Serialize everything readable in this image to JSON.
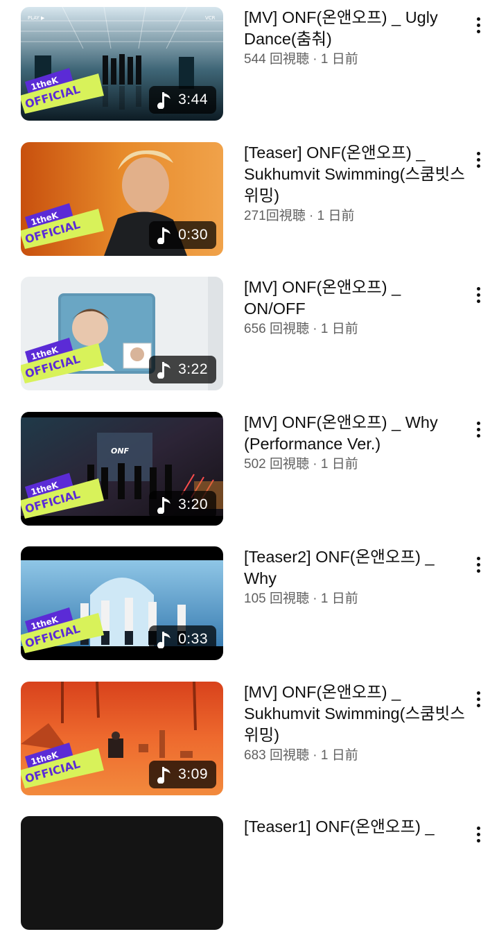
{
  "badge": {
    "brand": "1theK",
    "label": "OFFICIAL"
  },
  "videos": [
    {
      "title": "[MV] ONF(온앤오프) _ Ugly Dance(춤춰)",
      "views": "544 回視聴",
      "age": "1 日前",
      "duration": "3:44",
      "theme": "hall"
    },
    {
      "title": "[Teaser] ONF(온앤오프) _ Sukhumvit Swimming(스쿰빗스위밍)",
      "views": "271回視聴",
      "age": "1 日前",
      "duration": "0:30",
      "theme": "orange-portrait"
    },
    {
      "title": "[MV] ONF(온앤오프) _ ON/OFF",
      "views": "656 回視聴",
      "age": "1 日前",
      "duration": "3:22",
      "theme": "mirror"
    },
    {
      "title": "[MV] ONF(온앤오프) _ Why (Performance Ver.)",
      "views": "502 回視聴",
      "age": "1 日前",
      "duration": "3:20",
      "theme": "warehouse"
    },
    {
      "title": "[Teaser2] ONF(온앤오프) _ Why",
      "views": "105 回視聴",
      "age": "1 日前",
      "duration": "0:33",
      "theme": "blue-dance"
    },
    {
      "title": "[MV] ONF(온앤오프) _ Sukhumvit Swimming(스쿰빗스위밍)",
      "views": "683 回視聴",
      "age": "1 日前",
      "duration": "3:09",
      "theme": "desert"
    },
    {
      "title": "[Teaser1] ONF(온앤오프) _",
      "views": "",
      "age": "",
      "duration": "",
      "theme": "dark"
    }
  ]
}
